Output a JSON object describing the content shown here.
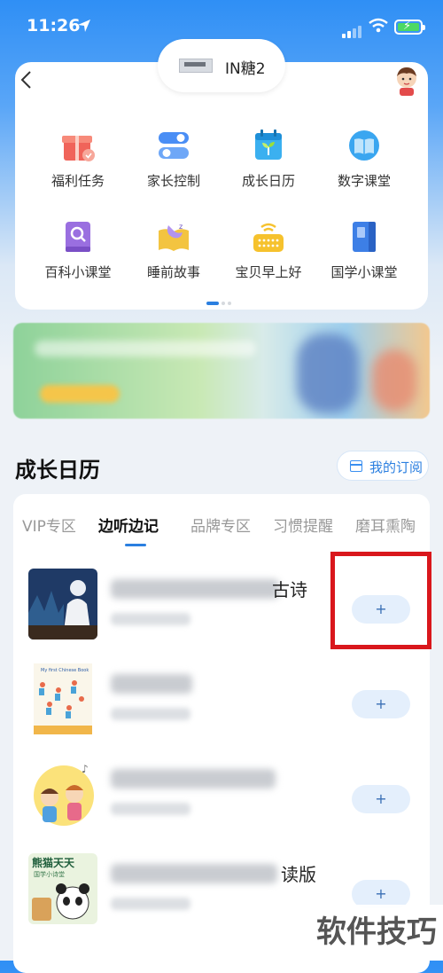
{
  "status_bar": {
    "time": "11:26"
  },
  "header": {
    "device_name": "IN糖2"
  },
  "grid_items": [
    {
      "label": "福利任务",
      "icon": "gift-icon",
      "color": "#f0645a"
    },
    {
      "label": "家长控制",
      "icon": "toggle-icon",
      "color": "#4a8ef5"
    },
    {
      "label": "成长日历",
      "icon": "calendar-sprout-icon",
      "color": "#3bb0f0"
    },
    {
      "label": "数字课堂",
      "icon": "book-icon",
      "color": "#3aa6f0"
    },
    {
      "label": "百科小课堂",
      "icon": "search-book-icon",
      "color": "#9a6fe0"
    },
    {
      "label": "睡前故事",
      "icon": "moon-book-icon",
      "color": "#f3c440"
    },
    {
      "label": "宝贝早上好",
      "icon": "radio-icon",
      "color": "#f6c22d"
    },
    {
      "label": "国学小课堂",
      "icon": "notebook-icon",
      "color": "#3d7fe6"
    }
  ],
  "section": {
    "title": "成长日历",
    "subscribe_label": "我的订阅"
  },
  "tabs": [
    {
      "label": "VIP专区",
      "active": false
    },
    {
      "label": "边听边记",
      "active": true
    },
    {
      "label": "品牌专区",
      "active": false
    },
    {
      "label": "习惯提醒",
      "active": false
    },
    {
      "label": "磨耳熏陶",
      "active": false
    }
  ],
  "list_items": [
    {
      "title_suffix": "古诗",
      "add_label": "+"
    },
    {
      "title_suffix": "",
      "add_label": "+"
    },
    {
      "title_suffix": "",
      "add_label": "+"
    },
    {
      "title_suffix": "读版",
      "add_label": "+"
    }
  ],
  "thumb_texts": {
    "panda_title": "熊猫天天",
    "panda_sub": "国学小诗堂",
    "book_title": "My first Chinese Book"
  },
  "watermark": "软件技巧"
}
